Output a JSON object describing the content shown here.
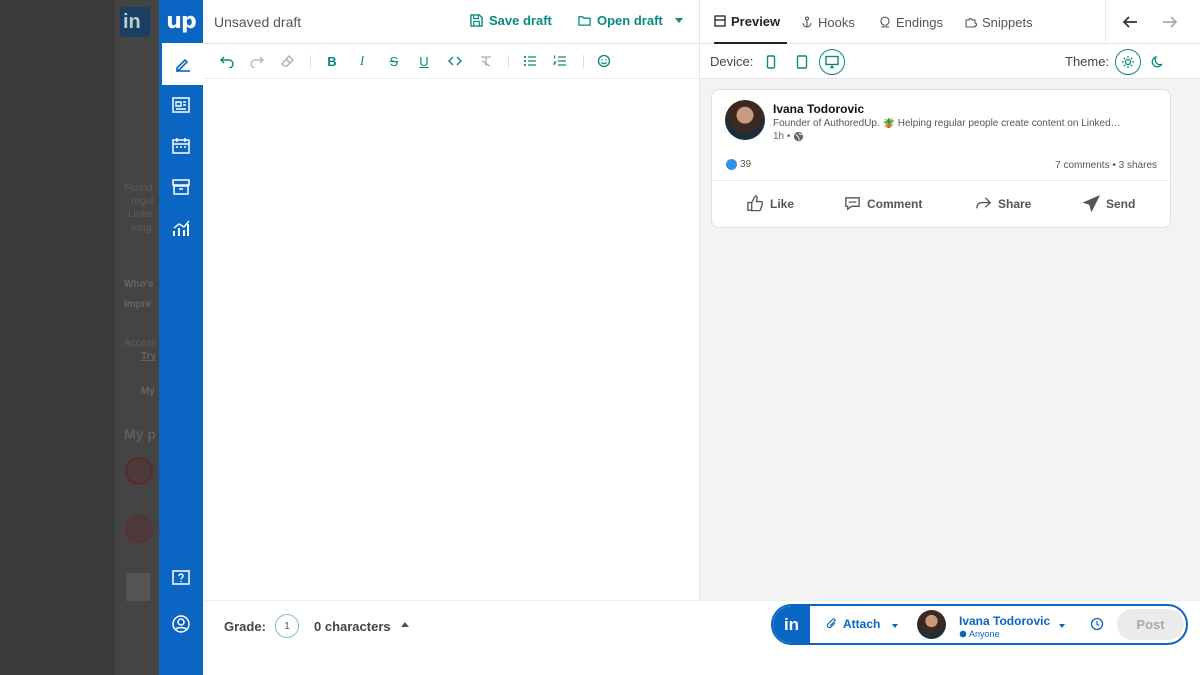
{
  "background_page": {
    "logo": "in",
    "snippets": [
      "Found",
      "regul",
      "Linke",
      "insig"
    ],
    "whos": "Who's",
    "impre": "Impre",
    "access": "Access",
    "try": "Try",
    "my": "My",
    "my_section": "My p"
  },
  "sidebar": {
    "logo": "up",
    "items": [
      {
        "name": "edit-icon",
        "active": true
      },
      {
        "name": "feed-icon"
      },
      {
        "name": "calendar-icon"
      },
      {
        "name": "archive-icon"
      },
      {
        "name": "analytics-icon"
      },
      {
        "name": "help-icon"
      },
      {
        "name": "account-icon"
      }
    ]
  },
  "editor": {
    "title": "Unsaved draft",
    "save_label": "Save draft",
    "open_label": "Open draft",
    "grade_label": "Grade:",
    "grade_value": "1",
    "characters": "0 characters"
  },
  "preview": {
    "tabs": [
      "Preview",
      "Hooks",
      "Endings",
      "Snippets"
    ],
    "device_label": "Device:",
    "theme_label": "Theme:",
    "post": {
      "author": "Ivana Todorovic",
      "headline": "Founder of AuthoredUp. 🪴 Helping regular people create content on Linked…",
      "time": "1h •",
      "likes": "39",
      "stats": "7 comments • 3 shares",
      "actions": [
        "Like",
        "Comment",
        "Share",
        "Send"
      ]
    }
  },
  "postbar": {
    "network": "in",
    "attach": "Attach",
    "account_name": "Ivana Todorovic",
    "visibility": "Anyone",
    "post_label": "Post"
  },
  "colors": {
    "brand": "#0a66c2",
    "accent": "#0a8a7e"
  }
}
